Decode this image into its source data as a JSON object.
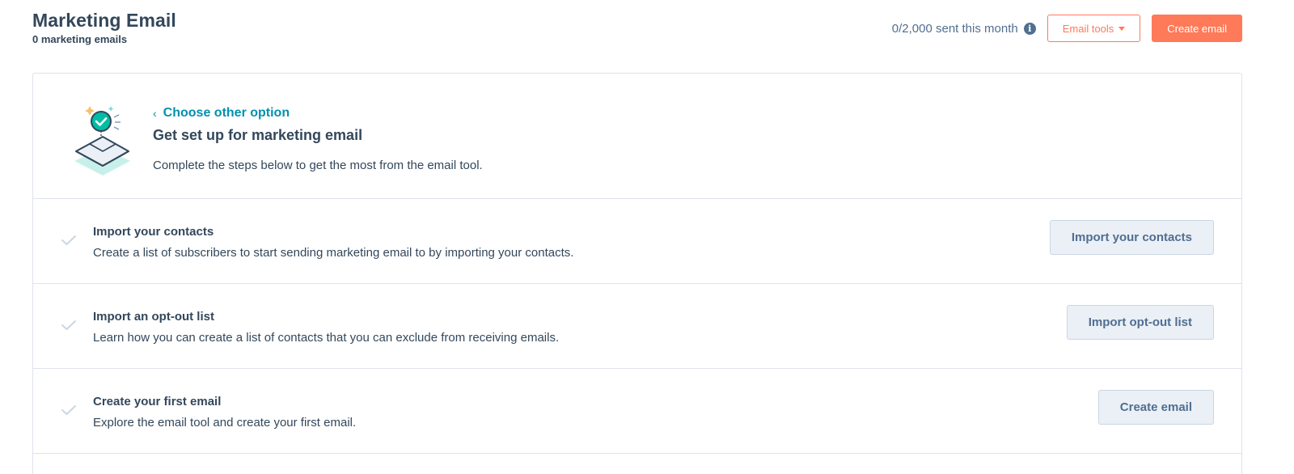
{
  "header": {
    "title": "Marketing Email",
    "subtitle": "0 marketing emails",
    "sent_count": "0/2,000 sent this month",
    "email_tools_label": "Email tools",
    "create_email_label": "Create email"
  },
  "intro": {
    "back_link": "Choose other option",
    "title": "Get set up for marketing email",
    "description": "Complete the steps below to get the most from the email tool."
  },
  "steps": [
    {
      "title": "Import your contacts",
      "description": "Create a list of subscribers to start sending marketing email to by importing your contacts.",
      "button": "Import your contacts"
    },
    {
      "title": "Import an opt-out list",
      "description": "Learn how you can create a list of contacts that you can exclude from receiving emails.",
      "button": "Import opt-out list"
    },
    {
      "title": "Create your first email",
      "description": "Explore the email tool and create your first email.",
      "button": "Create email"
    }
  ],
  "colors": {
    "accent": "#ff7a59",
    "link": "#0091ae",
    "text": "#33475b",
    "border": "#dfe3eb"
  },
  "icons": {
    "info": "info-icon",
    "caret": "caret-down-icon",
    "back": "chevron-left-icon",
    "check": "check-icon",
    "illustration": "envelope-badge-illustration"
  }
}
